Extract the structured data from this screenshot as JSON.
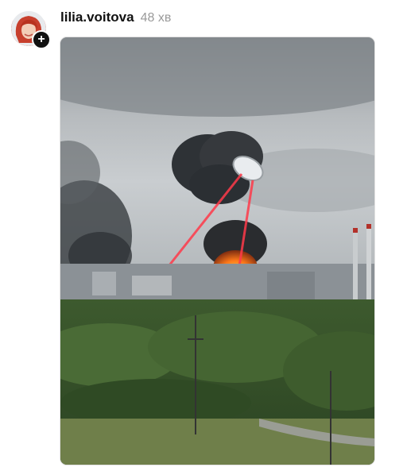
{
  "post": {
    "author": {
      "username": "lilia.voitova",
      "avatar_icon": "avatar-photo",
      "follow_icon": "plus-icon"
    },
    "timestamp": "48 хв",
    "media": {
      "type": "photo"
    }
  },
  "colors": {
    "username": "#111111",
    "timestamp": "#9a9a9a",
    "laser": "#ff3a4a",
    "fire": "#ff7a1a"
  }
}
